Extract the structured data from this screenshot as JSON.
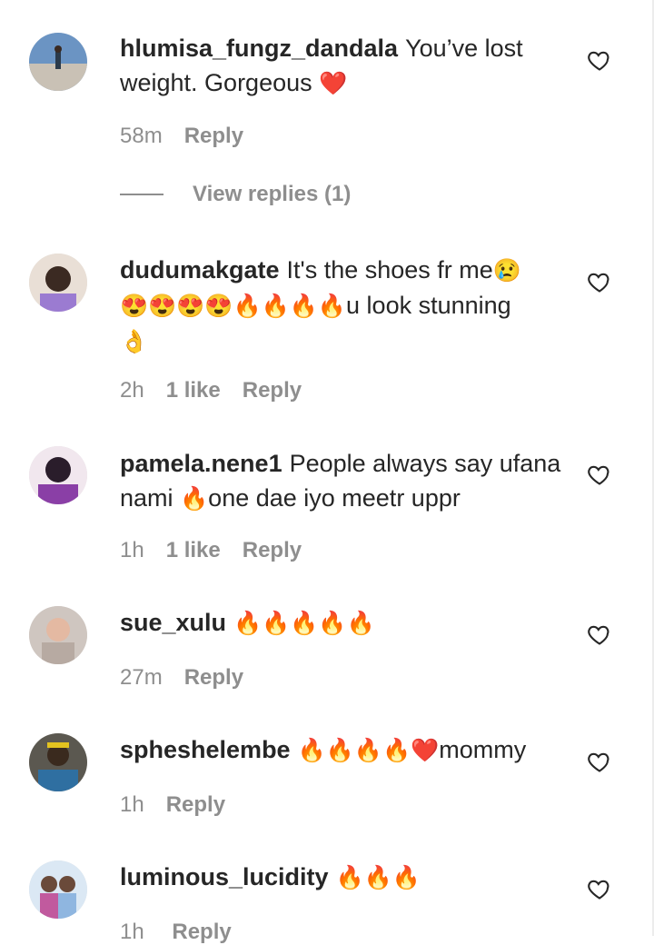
{
  "comments": [
    {
      "username": "hlumisa_fungz_dandala",
      "text": "You’ve lost weight. Gorgeous ",
      "emojis": "❤️",
      "time": "58m",
      "likes": "",
      "reply_label": "Reply",
      "view_replies": "View replies (1)",
      "avatar_colors": [
        "#5a86b7",
        "#c9c1b5"
      ]
    },
    {
      "username": "dudumakgate",
      "text": "It's the shoes fr me",
      "emojis": "😢",
      "line2_emojis": "😍😍😍😍🔥🔥🔥🔥",
      "line2_text": "u look stunning",
      "line3_emojis": "👌",
      "time": "2h",
      "likes": "1 like",
      "reply_label": "Reply",
      "avatar_colors": [
        "#3b2a22",
        "#9b7bd1"
      ]
    },
    {
      "username": "pamela.nene1",
      "text": "People always say ufana nami ",
      "emojis": "🔥",
      "text_after": "one dae iyo meetr uppr",
      "time": "1h",
      "likes": "1 like",
      "reply_label": "Reply",
      "avatar_colors": [
        "#2a1d2b",
        "#8a3fa6"
      ]
    },
    {
      "username": "sue_xulu",
      "text": "",
      "emojis": "🔥🔥🔥🔥🔥",
      "time": "27m",
      "likes": "",
      "reply_label": "Reply",
      "avatar_colors": [
        "#cfc6c0",
        "#e4b9a2"
      ]
    },
    {
      "username": "spheshelembe",
      "text": "",
      "emojis": "🔥🔥🔥🔥❤️",
      "text_after": "mommy",
      "time": "1h",
      "likes": "",
      "reply_label": "Reply",
      "avatar_colors": [
        "#5b5850",
        "#2f6fa1"
      ]
    },
    {
      "username": "luminous_lucidity",
      "text": "",
      "emojis": "🔥🔥🔥",
      "time": "1h",
      "reply_label": "Reply",
      "avatar_colors": [
        "#8fb6e0",
        "#c15a9e"
      ]
    }
  ],
  "icons": {
    "like": "heart-outline-icon"
  },
  "colors": {
    "text": "#262626",
    "meta": "#8e8e8e",
    "background": "#ffffff"
  }
}
